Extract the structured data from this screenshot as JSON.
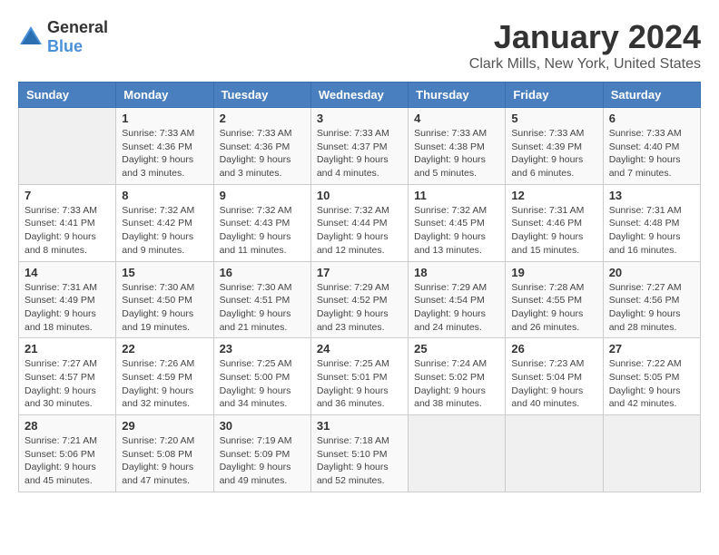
{
  "logo": {
    "text_general": "General",
    "text_blue": "Blue"
  },
  "title": "January 2024",
  "location": "Clark Mills, New York, United States",
  "days_of_week": [
    "Sunday",
    "Monday",
    "Tuesday",
    "Wednesday",
    "Thursday",
    "Friday",
    "Saturday"
  ],
  "weeks": [
    [
      {
        "day": "",
        "info": ""
      },
      {
        "day": "1",
        "info": "Sunrise: 7:33 AM\nSunset: 4:36 PM\nDaylight: 9 hours\nand 3 minutes."
      },
      {
        "day": "2",
        "info": "Sunrise: 7:33 AM\nSunset: 4:36 PM\nDaylight: 9 hours\nand 3 minutes."
      },
      {
        "day": "3",
        "info": "Sunrise: 7:33 AM\nSunset: 4:37 PM\nDaylight: 9 hours\nand 4 minutes."
      },
      {
        "day": "4",
        "info": "Sunrise: 7:33 AM\nSunset: 4:38 PM\nDaylight: 9 hours\nand 5 minutes."
      },
      {
        "day": "5",
        "info": "Sunrise: 7:33 AM\nSunset: 4:39 PM\nDaylight: 9 hours\nand 6 minutes."
      },
      {
        "day": "6",
        "info": "Sunrise: 7:33 AM\nSunset: 4:40 PM\nDaylight: 9 hours\nand 7 minutes."
      }
    ],
    [
      {
        "day": "7",
        "info": "Sunrise: 7:33 AM\nSunset: 4:41 PM\nDaylight: 9 hours\nand 8 minutes."
      },
      {
        "day": "8",
        "info": "Sunrise: 7:32 AM\nSunset: 4:42 PM\nDaylight: 9 hours\nand 9 minutes."
      },
      {
        "day": "9",
        "info": "Sunrise: 7:32 AM\nSunset: 4:43 PM\nDaylight: 9 hours\nand 11 minutes."
      },
      {
        "day": "10",
        "info": "Sunrise: 7:32 AM\nSunset: 4:44 PM\nDaylight: 9 hours\nand 12 minutes."
      },
      {
        "day": "11",
        "info": "Sunrise: 7:32 AM\nSunset: 4:45 PM\nDaylight: 9 hours\nand 13 minutes."
      },
      {
        "day": "12",
        "info": "Sunrise: 7:31 AM\nSunset: 4:46 PM\nDaylight: 9 hours\nand 15 minutes."
      },
      {
        "day": "13",
        "info": "Sunrise: 7:31 AM\nSunset: 4:48 PM\nDaylight: 9 hours\nand 16 minutes."
      }
    ],
    [
      {
        "day": "14",
        "info": "Sunrise: 7:31 AM\nSunset: 4:49 PM\nDaylight: 9 hours\nand 18 minutes."
      },
      {
        "day": "15",
        "info": "Sunrise: 7:30 AM\nSunset: 4:50 PM\nDaylight: 9 hours\nand 19 minutes."
      },
      {
        "day": "16",
        "info": "Sunrise: 7:30 AM\nSunset: 4:51 PM\nDaylight: 9 hours\nand 21 minutes."
      },
      {
        "day": "17",
        "info": "Sunrise: 7:29 AM\nSunset: 4:52 PM\nDaylight: 9 hours\nand 23 minutes."
      },
      {
        "day": "18",
        "info": "Sunrise: 7:29 AM\nSunset: 4:54 PM\nDaylight: 9 hours\nand 24 minutes."
      },
      {
        "day": "19",
        "info": "Sunrise: 7:28 AM\nSunset: 4:55 PM\nDaylight: 9 hours\nand 26 minutes."
      },
      {
        "day": "20",
        "info": "Sunrise: 7:27 AM\nSunset: 4:56 PM\nDaylight: 9 hours\nand 28 minutes."
      }
    ],
    [
      {
        "day": "21",
        "info": "Sunrise: 7:27 AM\nSunset: 4:57 PM\nDaylight: 9 hours\nand 30 minutes."
      },
      {
        "day": "22",
        "info": "Sunrise: 7:26 AM\nSunset: 4:59 PM\nDaylight: 9 hours\nand 32 minutes."
      },
      {
        "day": "23",
        "info": "Sunrise: 7:25 AM\nSunset: 5:00 PM\nDaylight: 9 hours\nand 34 minutes."
      },
      {
        "day": "24",
        "info": "Sunrise: 7:25 AM\nSunset: 5:01 PM\nDaylight: 9 hours\nand 36 minutes."
      },
      {
        "day": "25",
        "info": "Sunrise: 7:24 AM\nSunset: 5:02 PM\nDaylight: 9 hours\nand 38 minutes."
      },
      {
        "day": "26",
        "info": "Sunrise: 7:23 AM\nSunset: 5:04 PM\nDaylight: 9 hours\nand 40 minutes."
      },
      {
        "day": "27",
        "info": "Sunrise: 7:22 AM\nSunset: 5:05 PM\nDaylight: 9 hours\nand 42 minutes."
      }
    ],
    [
      {
        "day": "28",
        "info": "Sunrise: 7:21 AM\nSunset: 5:06 PM\nDaylight: 9 hours\nand 45 minutes."
      },
      {
        "day": "29",
        "info": "Sunrise: 7:20 AM\nSunset: 5:08 PM\nDaylight: 9 hours\nand 47 minutes."
      },
      {
        "day": "30",
        "info": "Sunrise: 7:19 AM\nSunset: 5:09 PM\nDaylight: 9 hours\nand 49 minutes."
      },
      {
        "day": "31",
        "info": "Sunrise: 7:18 AM\nSunset: 5:10 PM\nDaylight: 9 hours\nand 52 minutes."
      },
      {
        "day": "",
        "info": ""
      },
      {
        "day": "",
        "info": ""
      },
      {
        "day": "",
        "info": ""
      }
    ]
  ]
}
